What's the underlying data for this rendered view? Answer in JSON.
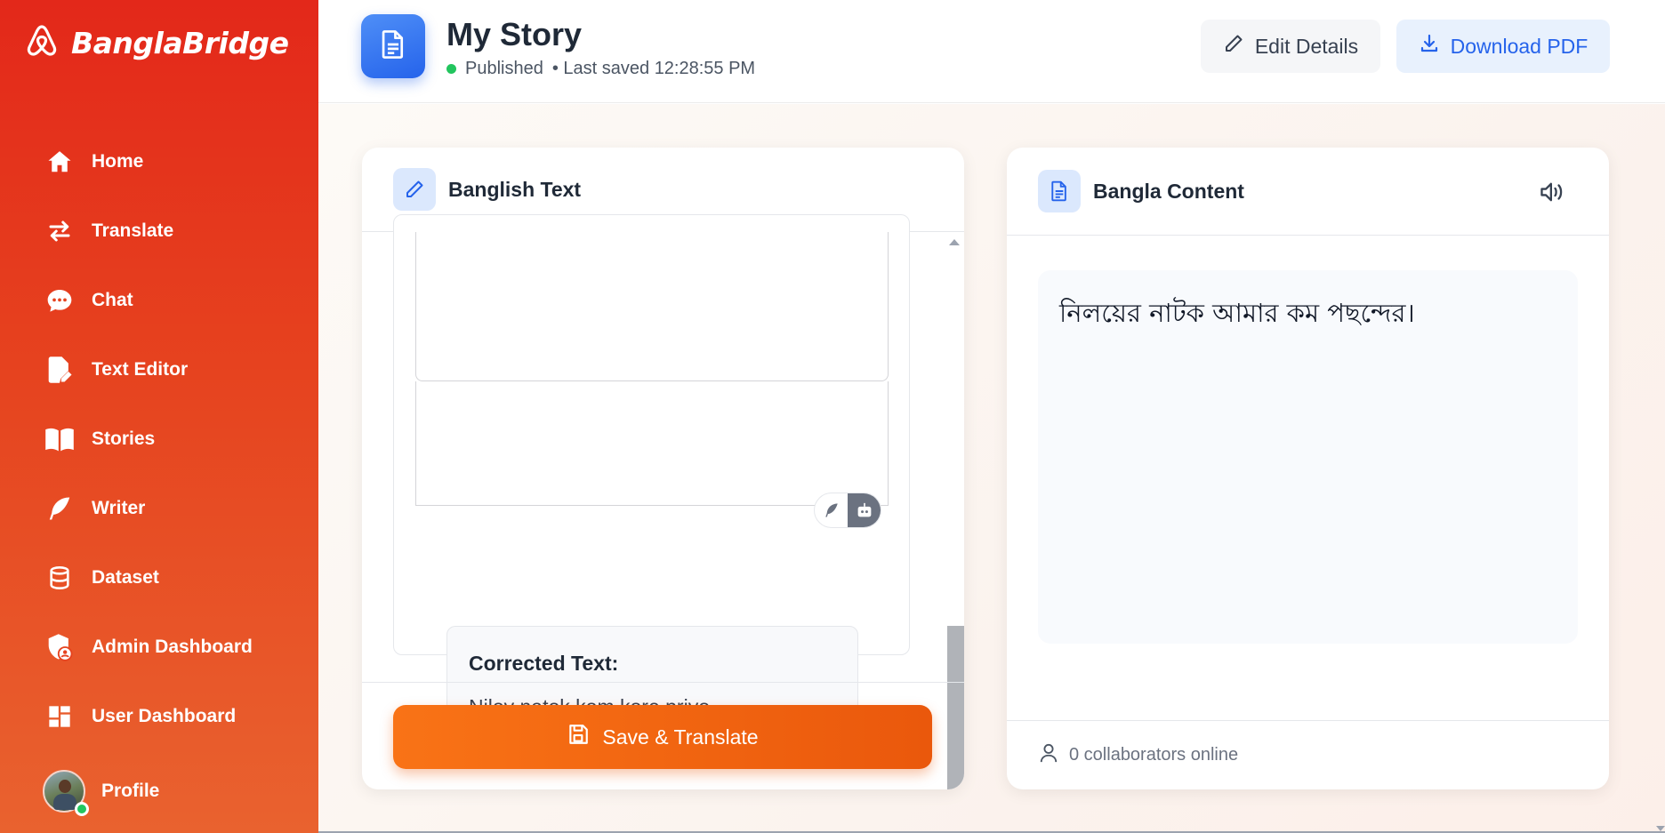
{
  "brand": {
    "name": "BanglaBridge"
  },
  "sidebar": {
    "items": [
      {
        "label": "Home",
        "icon": "home-icon"
      },
      {
        "label": "Translate",
        "icon": "swap-arrows-icon"
      },
      {
        "label": "Chat",
        "icon": "chat-bubble-icon"
      },
      {
        "label": "Text Editor",
        "icon": "edit-document-icon"
      },
      {
        "label": "Stories",
        "icon": "book-icon"
      },
      {
        "label": "Writer",
        "icon": "feather-icon"
      },
      {
        "label": "Dataset",
        "icon": "database-icon"
      },
      {
        "label": "Admin Dashboard",
        "icon": "shield-user-icon"
      },
      {
        "label": "User Dashboard",
        "icon": "dashboard-grid-icon"
      }
    ],
    "profile": {
      "label": "Profile"
    }
  },
  "header": {
    "title": "My Story",
    "status": "Published",
    "last_saved": "• Last saved 12:28:55 PM",
    "edit_label": "Edit Details",
    "download_label": "Download PDF"
  },
  "left_panel": {
    "title": "Banglish Text",
    "corrected_title": "Corrected Text:",
    "corrected_text": "Niloy natok kom kore priyo",
    "save_label": "Save & Translate"
  },
  "right_panel": {
    "title": "Bangla Content",
    "content": "নিলয়ের নাটক আমার কম পছন্দের।",
    "collaborators": "0 collaborators online"
  },
  "colors": {
    "sidebar_top": "#e3281a",
    "sidebar_bottom": "#e9622f",
    "primary_blue": "#2563eb",
    "accent_orange": "#f97316",
    "online_green": "#22c55e"
  }
}
